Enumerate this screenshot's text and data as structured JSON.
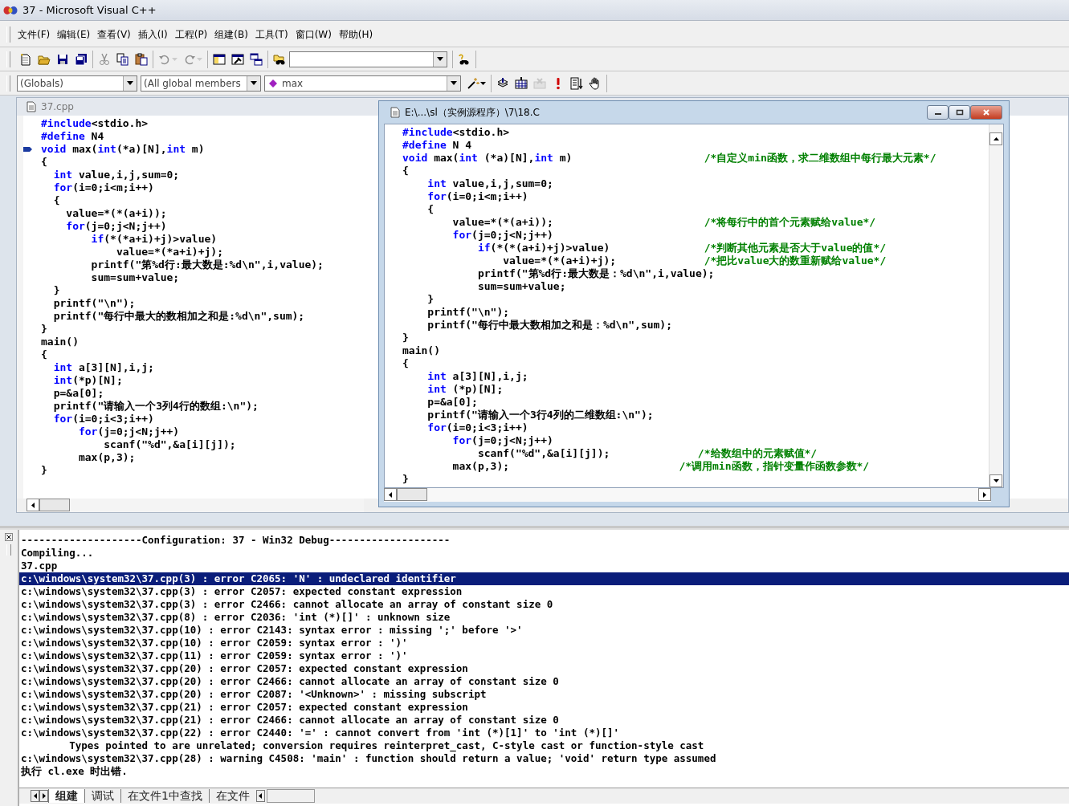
{
  "window": {
    "title": "37 - Microsoft Visual C++"
  },
  "menu": [
    "文件(F)",
    "编辑(E)",
    "查看(V)",
    "插入(I)",
    "工程(P)",
    "组建(B)",
    "工具(T)",
    "窗口(W)",
    "帮助(H)"
  ],
  "toolbar_1": [
    [
      {
        "kind": "new-file",
        "disabled": false
      },
      {
        "kind": "open",
        "disabled": false
      },
      {
        "kind": "save",
        "disabled": false
      },
      {
        "kind": "save-all",
        "disabled": false
      }
    ],
    [
      {
        "kind": "cut",
        "disabled": true
      },
      {
        "kind": "copy",
        "disabled": false
      },
      {
        "kind": "paste",
        "disabled": false
      }
    ],
    [
      {
        "kind": "undo",
        "disabled": true
      },
      {
        "kind": "redo",
        "disabled": true
      }
    ],
    [
      {
        "kind": "workspace",
        "disabled": false
      },
      {
        "kind": "output",
        "disabled": false
      },
      {
        "kind": "window-list",
        "disabled": false
      }
    ],
    [
      {
        "kind": "find-in-files",
        "disabled": false
      },
      {
        "kind": "combo"
      }
    ],
    [
      {
        "kind": "help-search",
        "disabled": false
      }
    ]
  ],
  "toolbar_2": [
    [
      {
        "kind": "combo",
        "value": "(Globals)"
      },
      {
        "kind": "combo",
        "value": "(All global members"
      },
      {
        "kind": "symbol-combo",
        "value": "max"
      },
      {
        "kind": "wizard",
        "disabled": false
      }
    ],
    [
      {
        "kind": "compile",
        "disabled": false
      },
      {
        "kind": "build",
        "disabled": false
      },
      {
        "kind": "stop",
        "disabled": true
      },
      {
        "kind": "execute",
        "disabled": false
      },
      {
        "kind": "step",
        "disabled": false
      },
      {
        "kind": "breakpoint",
        "disabled": false
      }
    ]
  ],
  "editor_back": {
    "title": "37.cpp",
    "active": false,
    "lines": [
      {
        "marked": false,
        "segments": [
          {
            "kind": "keyword",
            "text": "#include"
          },
          {
            "kind": "plain",
            "text": "<stdio.h>"
          }
        ]
      },
      {
        "marked": false,
        "segments": [
          {
            "kind": "keyword",
            "text": "#define"
          },
          {
            "kind": "plain",
            "text": " N4"
          }
        ]
      },
      {
        "marked": true,
        "segments": [
          {
            "kind": "keyword",
            "text": "void"
          },
          {
            "kind": "plain",
            "text": " max("
          },
          {
            "kind": "keyword",
            "text": "int"
          },
          {
            "kind": "plain",
            "text": "(*a)[N],"
          },
          {
            "kind": "keyword",
            "text": "int"
          },
          {
            "kind": "plain",
            "text": " m)"
          }
        ]
      },
      {
        "marked": false,
        "segments": [
          {
            "kind": "plain",
            "text": "{"
          }
        ]
      },
      {
        "marked": false,
        "segments": [
          {
            "kind": "keyword",
            "text": "  int"
          },
          {
            "kind": "plain",
            "text": " value,i,j,sum=0;"
          }
        ]
      },
      {
        "marked": false,
        "segments": [
          {
            "kind": "keyword",
            "text": "  for"
          },
          {
            "kind": "plain",
            "text": "(i=0;i<m;i++)"
          }
        ]
      },
      {
        "marked": false,
        "segments": [
          {
            "kind": "plain",
            "text": "  {"
          }
        ]
      },
      {
        "marked": false,
        "segments": [
          {
            "kind": "plain",
            "text": "    value=*(*(a+i));"
          }
        ]
      },
      {
        "marked": false,
        "segments": [
          {
            "kind": "keyword",
            "text": "    for"
          },
          {
            "kind": "plain",
            "text": "(j=0;j<N;j++)"
          }
        ]
      },
      {
        "marked": false,
        "segments": [
          {
            "kind": "keyword",
            "text": "        if"
          },
          {
            "kind": "plain",
            "text": "(*(*a+i)+j)>value)"
          }
        ]
      },
      {
        "marked": false,
        "segments": [
          {
            "kind": "plain",
            "text": "            value=*(*a+i)+j);"
          }
        ]
      },
      {
        "marked": false,
        "segments": [
          {
            "kind": "plain",
            "text": "        printf(\"第%d行:最大数是:%d\\n\",i,value);"
          }
        ]
      },
      {
        "marked": false,
        "segments": [
          {
            "kind": "plain",
            "text": "        sum=sum+value;"
          }
        ]
      },
      {
        "marked": false,
        "segments": [
          {
            "kind": "plain",
            "text": "  }"
          }
        ]
      },
      {
        "marked": false,
        "segments": [
          {
            "kind": "plain",
            "text": "  printf(\"\\n\");"
          }
        ]
      },
      {
        "marked": false,
        "segments": [
          {
            "kind": "plain",
            "text": "  printf(\"每行中最大的数相加之和是:%d\\n\",sum);"
          }
        ]
      },
      {
        "marked": false,
        "segments": [
          {
            "kind": "plain",
            "text": "}"
          }
        ]
      },
      {
        "marked": false,
        "segments": [
          {
            "kind": "plain",
            "text": "main()"
          }
        ]
      },
      {
        "marked": false,
        "segments": [
          {
            "kind": "plain",
            "text": "{"
          }
        ]
      },
      {
        "marked": false,
        "segments": [
          {
            "kind": "keyword",
            "text": "  int"
          },
          {
            "kind": "plain",
            "text": " a[3][N],i,j;"
          }
        ]
      },
      {
        "marked": false,
        "segments": [
          {
            "kind": "keyword",
            "text": "  int"
          },
          {
            "kind": "plain",
            "text": "(*p)[N];"
          }
        ]
      },
      {
        "marked": false,
        "segments": [
          {
            "kind": "plain",
            "text": "  p=&a[0];"
          }
        ]
      },
      {
        "marked": false,
        "segments": [
          {
            "kind": "plain",
            "text": "  printf(\"请输入一个3列4行的数组:\\n\");"
          }
        ]
      },
      {
        "marked": false,
        "segments": [
          {
            "kind": "keyword",
            "text": "  for"
          },
          {
            "kind": "plain",
            "text": "(i=0;i<3;i++)"
          }
        ]
      },
      {
        "marked": false,
        "segments": [
          {
            "kind": "keyword",
            "text": "      for"
          },
          {
            "kind": "plain",
            "text": "(j=0;j<N;j++)"
          }
        ]
      },
      {
        "marked": false,
        "segments": [
          {
            "kind": "plain",
            "text": "          scanf(\"%d\",&a[i][j]);"
          }
        ]
      },
      {
        "marked": false,
        "segments": [
          {
            "kind": "plain",
            "text": "      max(p,3);"
          }
        ]
      },
      {
        "marked": false,
        "segments": [
          {
            "kind": "plain",
            "text": "}"
          }
        ]
      }
    ]
  },
  "editor_front": {
    "title": "E:\\...\\sl（实例源程序）\\7\\18.C",
    "active": true,
    "lines": [
      {
        "segments": [
          {
            "kind": "keyword",
            "text": "#include"
          },
          {
            "kind": "plain",
            "text": "<stdio.h>"
          }
        ]
      },
      {
        "segments": [
          {
            "kind": "keyword",
            "text": "#define"
          },
          {
            "kind": "plain",
            "text": " N 4"
          }
        ]
      },
      {
        "segments": [
          {
            "kind": "keyword",
            "text": "void"
          },
          {
            "kind": "plain",
            "text": " max("
          },
          {
            "kind": "keyword",
            "text": "int"
          },
          {
            "kind": "plain",
            "text": " (*a)[N],"
          },
          {
            "kind": "keyword",
            "text": "int"
          },
          {
            "kind": "plain",
            "text": " m)                     "
          },
          {
            "kind": "comment",
            "text": "/*自定义min函数，求二维数组中每行最大元素*/"
          }
        ]
      },
      {
        "segments": [
          {
            "kind": "plain",
            "text": "{"
          }
        ]
      },
      {
        "segments": [
          {
            "kind": "keyword",
            "text": "    int"
          },
          {
            "kind": "plain",
            "text": " value,i,j,sum=0;"
          }
        ]
      },
      {
        "segments": [
          {
            "kind": "keyword",
            "text": "    for"
          },
          {
            "kind": "plain",
            "text": "(i=0;i<m;i++)"
          }
        ]
      },
      {
        "segments": [
          {
            "kind": "plain",
            "text": "    {"
          }
        ]
      },
      {
        "segments": [
          {
            "kind": "plain",
            "text": "        value=*(*(a+i));                        "
          },
          {
            "kind": "comment",
            "text": "/*将每行中的首个元素赋给value*/"
          }
        ]
      },
      {
        "segments": [
          {
            "kind": "keyword",
            "text": "        for"
          },
          {
            "kind": "plain",
            "text": "(j=0;j<N;j++)"
          }
        ]
      },
      {
        "segments": [
          {
            "kind": "keyword",
            "text": "            if"
          },
          {
            "kind": "plain",
            "text": "(*(*(a+i)+j)>value)               "
          },
          {
            "kind": "comment",
            "text": "/*判断其他元素是否大于value的值*/"
          }
        ]
      },
      {
        "segments": [
          {
            "kind": "plain",
            "text": "                value=*(*(a+i)+j);              "
          },
          {
            "kind": "comment",
            "text": "/*把比value大的数重新赋给value*/"
          }
        ]
      },
      {
        "segments": [
          {
            "kind": "plain",
            "text": "            printf(\"第%d行:最大数是：%d\\n\",i,value);"
          }
        ]
      },
      {
        "segments": [
          {
            "kind": "plain",
            "text": "            sum=sum+value;"
          }
        ]
      },
      {
        "segments": [
          {
            "kind": "plain",
            "text": "    }"
          }
        ]
      },
      {
        "segments": [
          {
            "kind": "plain",
            "text": "    printf(\"\\n\");"
          }
        ]
      },
      {
        "segments": [
          {
            "kind": "plain",
            "text": "    printf(\"每行中最大数相加之和是：%d\\n\",sum);"
          }
        ]
      },
      {
        "segments": [
          {
            "kind": "plain",
            "text": "}"
          }
        ]
      },
      {
        "segments": [
          {
            "kind": "plain",
            "text": "main()"
          }
        ]
      },
      {
        "segments": [
          {
            "kind": "plain",
            "text": "{"
          }
        ]
      },
      {
        "segments": [
          {
            "kind": "keyword",
            "text": "    int"
          },
          {
            "kind": "plain",
            "text": " a[3][N],i,j;"
          }
        ]
      },
      {
        "segments": [
          {
            "kind": "keyword",
            "text": "    int"
          },
          {
            "kind": "plain",
            "text": " (*p)[N];"
          }
        ]
      },
      {
        "segments": [
          {
            "kind": "plain",
            "text": "    p=&a[0];"
          }
        ]
      },
      {
        "segments": [
          {
            "kind": "plain",
            "text": "    printf(\"请输入一个3行4列的二维数组:\\n\");"
          }
        ]
      },
      {
        "segments": [
          {
            "kind": "keyword",
            "text": "    for"
          },
          {
            "kind": "plain",
            "text": "(i=0;i<3;i++)"
          }
        ]
      },
      {
        "segments": [
          {
            "kind": "keyword",
            "text": "        for"
          },
          {
            "kind": "plain",
            "text": "(j=0;j<N;j++)"
          }
        ]
      },
      {
        "segments": [
          {
            "kind": "plain",
            "text": "            scanf(\"%d\",&a[i][j]);              "
          },
          {
            "kind": "comment",
            "text": "/*给数组中的元素赋值*/"
          }
        ]
      },
      {
        "segments": [
          {
            "kind": "plain",
            "text": "        max(p,3);                           "
          },
          {
            "kind": "comment",
            "text": "/*调用min函数，指针变量作函数参数*/"
          }
        ]
      },
      {
        "segments": [
          {
            "kind": "plain",
            "text": "}"
          }
        ]
      }
    ]
  },
  "output": {
    "lines": [
      {
        "text": "--------------------Configuration: 37 - Win32 Debug--------------------",
        "selected": false
      },
      {
        "text": "Compiling...",
        "selected": false
      },
      {
        "text": "37.cpp",
        "selected": false
      },
      {
        "text": "c:\\windows\\system32\\37.cpp(3) : error C2065: 'N' : undeclared identifier",
        "selected": true
      },
      {
        "text": "c:\\windows\\system32\\37.cpp(3) : error C2057: expected constant expression",
        "selected": false
      },
      {
        "text": "c:\\windows\\system32\\37.cpp(3) : error C2466: cannot allocate an array of constant size 0",
        "selected": false
      },
      {
        "text": "c:\\windows\\system32\\37.cpp(8) : error C2036: 'int (*)[]' : unknown size",
        "selected": false
      },
      {
        "text": "c:\\windows\\system32\\37.cpp(10) : error C2143: syntax error : missing ';' before '>'",
        "selected": false
      },
      {
        "text": "c:\\windows\\system32\\37.cpp(10) : error C2059: syntax error : ')'",
        "selected": false
      },
      {
        "text": "c:\\windows\\system32\\37.cpp(11) : error C2059: syntax error : ')'",
        "selected": false
      },
      {
        "text": "c:\\windows\\system32\\37.cpp(20) : error C2057: expected constant expression",
        "selected": false
      },
      {
        "text": "c:\\windows\\system32\\37.cpp(20) : error C2466: cannot allocate an array of constant size 0",
        "selected": false
      },
      {
        "text": "c:\\windows\\system32\\37.cpp(20) : error C2087: '<Unknown>' : missing subscript",
        "selected": false
      },
      {
        "text": "c:\\windows\\system32\\37.cpp(21) : error C2057: expected constant expression",
        "selected": false
      },
      {
        "text": "c:\\windows\\system32\\37.cpp(21) : error C2466: cannot allocate an array of constant size 0",
        "selected": false
      },
      {
        "text": "c:\\windows\\system32\\37.cpp(22) : error C2440: '=' : cannot convert from 'int (*)[1]' to 'int (*)[]'",
        "selected": false
      },
      {
        "text": "        Types pointed to are unrelated; conversion requires reinterpret_cast, C-style cast or function-style cast",
        "selected": false
      },
      {
        "text": "c:\\windows\\system32\\37.cpp(28) : warning C4508: 'main' : function should return a value; 'void' return type assumed",
        "selected": false
      },
      {
        "text": "执行 cl.exe 时出错.",
        "selected": false
      }
    ],
    "tabs": [
      {
        "label": "组建",
        "selected": true
      },
      {
        "label": "调试",
        "selected": false
      },
      {
        "label": "在文件1中查找",
        "selected": false
      },
      {
        "label": "在文件",
        "selected": false
      }
    ]
  }
}
